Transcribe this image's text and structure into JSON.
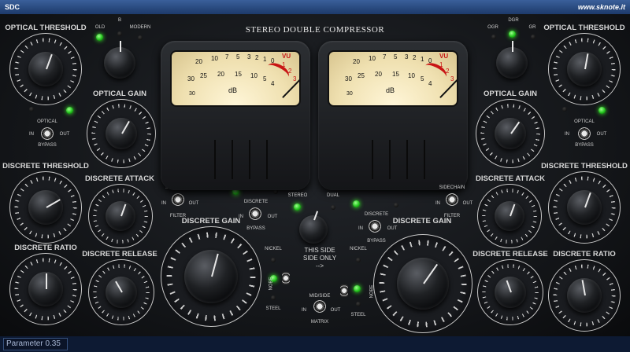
{
  "window": {
    "title": "SDC",
    "site": "www.sknote.it"
  },
  "plugin_title": "STEREO DOUBLE COMPRESSOR",
  "status": {
    "parameter": "Parameter 0.35"
  },
  "left": {
    "optical_threshold": "OPTICAL THRESHOLD",
    "mode": {
      "old": "OLD",
      "b": "B",
      "modern": "MODERN"
    },
    "optical_gain": "OPTICAL GAIN",
    "optical_bypass": {
      "top": "OPTICAL",
      "in": "IN",
      "out": "OUT",
      "bottom": "BYPASS"
    },
    "discrete_threshold": "DISCRETE THRESHOLD",
    "discrete_attack": "DISCRETE ATTACK",
    "sidechain": {
      "top": "SIDECHAIN",
      "in": "IN",
      "out": "OUT",
      "bottom": "FILTER"
    },
    "discrete_bypass": {
      "top": "DISCRETE",
      "in": "IN",
      "out": "OUT",
      "bottom": "BYPASS"
    },
    "discrete_ratio": "DISCRETE RATIO",
    "discrete_release": "DISCRETE RELEASE",
    "discrete_gain": "DISCRETE GAIN",
    "nickel": "NICKEL",
    "steel": "STEEL",
    "nobe": "NOBE"
  },
  "right": {
    "optical_threshold": "OPTICAL THRESHOLD",
    "meter_mode": {
      "ogr": "OGR",
      "dgr": "DGR",
      "gr": "GR"
    },
    "optical_gain": "OPTICAL GAIN",
    "optical_bypass": {
      "top": "OPTICAL",
      "in": "IN",
      "out": "OUT",
      "bottom": "BYPASS"
    },
    "discrete_threshold": "DISCRETE THRESHOLD",
    "discrete_attack": "DISCRETE ATTACK",
    "sidechain": {
      "top": "SIDECHAIN",
      "in": "IN",
      "out": "OUT",
      "bottom": "FILTER"
    },
    "discrete_bypass": {
      "top": "DISCRETE",
      "in": "IN",
      "out": "OUT",
      "bottom": "BYPASS"
    },
    "discrete_ratio": "DISCRETE RATIO",
    "discrete_release": "DISCRETE RELEASE",
    "discrete_gain": "DISCRETE GAIN",
    "nickel": "NICKEL",
    "steel": "STEEL",
    "nobe": "NOBE"
  },
  "center": {
    "stereo": "STEREO",
    "dual": "DUAL",
    "note": "THIS SIDE SIDE ONLY -->",
    "midside": {
      "top": "MID/SIDE",
      "in": "IN",
      "out": "OUT",
      "bottom": "MATRIX"
    }
  },
  "vu_meter": {
    "unit": "VU",
    "db": "dB",
    "black_scale": [
      "20",
      "10",
      "7",
      "5",
      "3",
      "2",
      "1",
      "0"
    ],
    "red_scale": [
      "1",
      "2",
      "3"
    ],
    "inner_scale": [
      "30",
      "25",
      "20",
      "15",
      "10",
      "5",
      "4"
    ]
  },
  "knob_scales": {
    "threshold": [
      "32",
      "30",
      "26",
      "22",
      "18",
      "14",
      "10",
      "6",
      "2",
      "0",
      "2",
      "6",
      "10",
      "14",
      "18",
      "22",
      "24"
    ],
    "gain": [
      "2",
      "6",
      "10",
      "14",
      "18",
      "22",
      "26",
      "28",
      "30",
      "32",
      "30",
      "28",
      "24",
      "20",
      "16",
      "12",
      "8"
    ],
    "attack_release": {
      "min": "MIN",
      "max": "MAX",
      "marks": [
        "1",
        "2",
        "3",
        "4",
        "5"
      ]
    },
    "ratio": {
      "marks": [
        "1",
        "2",
        "3",
        "4",
        "5",
        "6"
      ],
      "max": "MAX"
    }
  },
  "colors": {
    "led_on": "#21c21b",
    "panel": "#17191d",
    "titlebar": "#2a4b80",
    "vu_red": "#c81414"
  }
}
